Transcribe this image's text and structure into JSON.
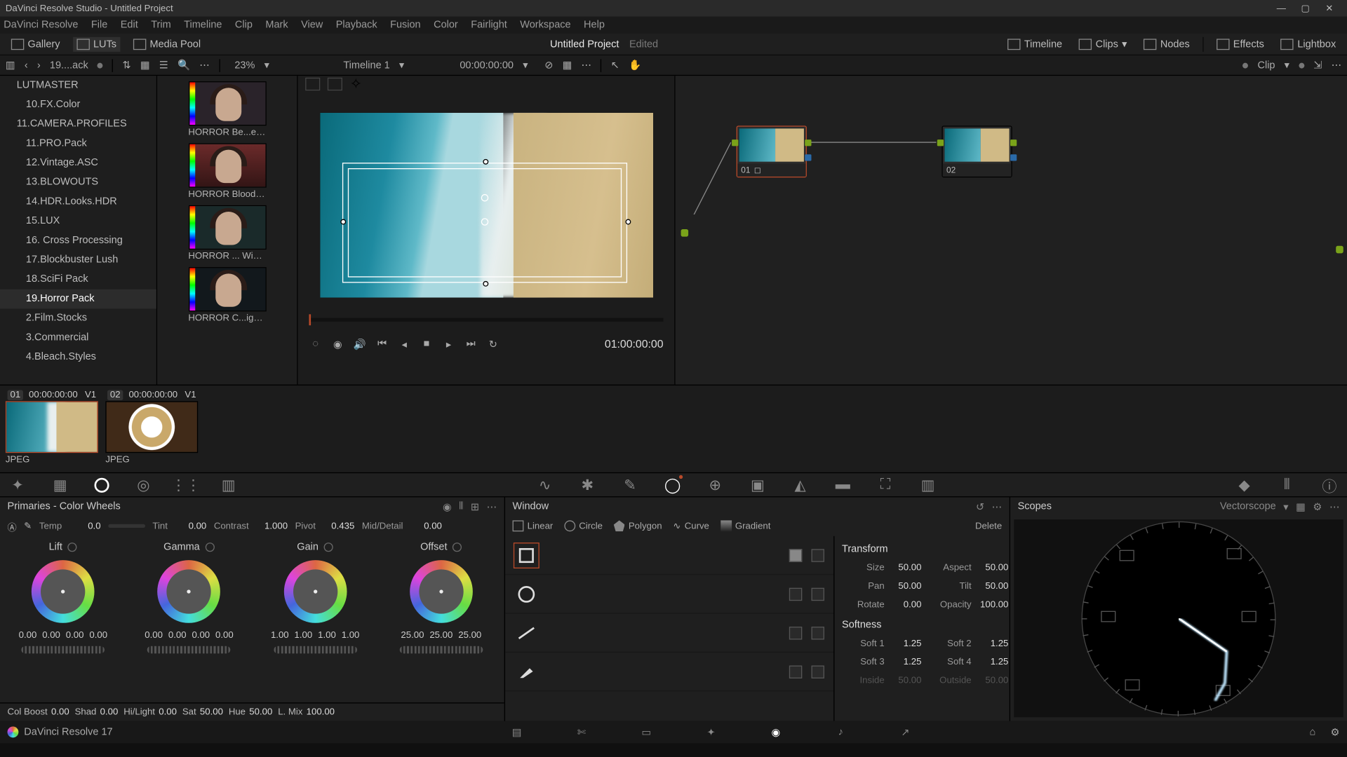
{
  "titlebar": {
    "title": "DaVinci Resolve Studio - Untitled Project"
  },
  "menubar": [
    "DaVinci Resolve",
    "File",
    "Edit",
    "Trim",
    "Timeline",
    "Clip",
    "Mark",
    "View",
    "Playback",
    "Fusion",
    "Color",
    "Fairlight",
    "Workspace",
    "Help"
  ],
  "toptool": {
    "gallery": "Gallery",
    "luts": "LUTs",
    "mediapool": "Media Pool",
    "project": "Untitled Project",
    "edited": "Edited",
    "timeline": "Timeline",
    "clips": "Clips",
    "nodes": "Nodes",
    "effects": "Effects",
    "lightbox": "Lightbox"
  },
  "tool2": {
    "browser_title": "19....ack",
    "zoom": "23%",
    "timeline": "Timeline 1",
    "timecode": "00:00:00:00",
    "clip": "Clip"
  },
  "leftnav": {
    "items": [
      {
        "label": "LUTMASTER",
        "cls": "master"
      },
      {
        "label": "10.FX.Color"
      },
      {
        "label": "11.CAMERA.PROFILES",
        "cls": "parent"
      },
      {
        "label": "11.PRO.Pack"
      },
      {
        "label": "12.Vintage.ASC"
      },
      {
        "label": "13.BLOWOUTS"
      },
      {
        "label": "14.HDR.Looks.HDR"
      },
      {
        "label": "15.LUX"
      },
      {
        "label": "16. Cross Processing"
      },
      {
        "label": "17.Blockbuster Lush"
      },
      {
        "label": "18.SciFi Pack"
      },
      {
        "label": "19.Horror Pack",
        "sel": true
      },
      {
        "label": "2.Film.Stocks"
      },
      {
        "label": "3.Commercial"
      },
      {
        "label": "4.Bleach.Styles"
      }
    ]
  },
  "thumbs": [
    {
      "label": "HORROR Be...e Stalker",
      "bg": "bg1"
    },
    {
      "label": "HORROR Blood Night",
      "bg": "bg2"
    },
    {
      "label": "HORROR ... Window",
      "bg": "bg3"
    },
    {
      "label": "HORROR C...ightmare",
      "bg": "bg4"
    }
  ],
  "viewer": {
    "timecode": "01:00:00:00"
  },
  "nodes": {
    "n1": {
      "label": "01"
    },
    "n2": {
      "label": "02"
    }
  },
  "clips": [
    {
      "num": "01",
      "tc": "00:00:00:00",
      "track": "V1",
      "label": "JPEG",
      "kind": "beach",
      "sel": true
    },
    {
      "num": "02",
      "tc": "00:00:00:00",
      "track": "V1",
      "label": "JPEG",
      "kind": "coffee"
    }
  ],
  "primaries": {
    "title": "Primaries - Color Wheels",
    "temp": {
      "label": "Temp",
      "value": "0.0"
    },
    "tint": {
      "label": "Tint",
      "value": "0.00"
    },
    "contrast": {
      "label": "Contrast",
      "value": "1.000"
    },
    "pivot": {
      "label": "Pivot",
      "value": "0.435"
    },
    "middetail": {
      "label": "Mid/Detail",
      "value": "0.00"
    },
    "wheels": [
      {
        "name": "Lift",
        "vals": [
          "0.00",
          "0.00",
          "0.00",
          "0.00"
        ]
      },
      {
        "name": "Gamma",
        "vals": [
          "0.00",
          "0.00",
          "0.00",
          "0.00"
        ]
      },
      {
        "name": "Gain",
        "vals": [
          "1.00",
          "1.00",
          "1.00",
          "1.00"
        ]
      },
      {
        "name": "Offset",
        "vals": [
          "25.00",
          "25.00",
          "25.00"
        ]
      }
    ],
    "bottom": {
      "colboost": {
        "label": "Col Boost",
        "value": "0.00"
      },
      "shad": {
        "label": "Shad",
        "value": "0.00"
      },
      "hilight": {
        "label": "Hi/Light",
        "value": "0.00"
      },
      "sat": {
        "label": "Sat",
        "value": "50.00"
      },
      "hue": {
        "label": "Hue",
        "value": "50.00"
      },
      "lmix": {
        "label": "L. Mix",
        "value": "100.00"
      }
    }
  },
  "window": {
    "title": "Window",
    "shapes": {
      "linear": "Linear",
      "circle": "Circle",
      "polygon": "Polygon",
      "curve": "Curve",
      "gradient": "Gradient",
      "delete": "Delete"
    },
    "transform": {
      "title": "Transform",
      "size": {
        "label": "Size",
        "value": "50.00"
      },
      "aspect": {
        "label": "Aspect",
        "value": "50.00"
      },
      "pan": {
        "label": "Pan",
        "value": "50.00"
      },
      "tilt": {
        "label": "Tilt",
        "value": "50.00"
      },
      "rotate": {
        "label": "Rotate",
        "value": "0.00"
      },
      "opacity": {
        "label": "Opacity",
        "value": "100.00"
      }
    },
    "softness": {
      "title": "Softness",
      "s1": {
        "label": "Soft 1",
        "value": "1.25"
      },
      "s2": {
        "label": "Soft 2",
        "value": "1.25"
      },
      "s3": {
        "label": "Soft 3",
        "value": "1.25"
      },
      "s4": {
        "label": "Soft 4",
        "value": "1.25"
      },
      "inside": {
        "label": "Inside",
        "value": "50.00"
      },
      "outside": {
        "label": "Outside",
        "value": "50.00"
      }
    }
  },
  "scopes": {
    "title": "Scopes",
    "type": "Vectorscope"
  },
  "pagebar": {
    "app": "DaVinci Resolve 17"
  }
}
